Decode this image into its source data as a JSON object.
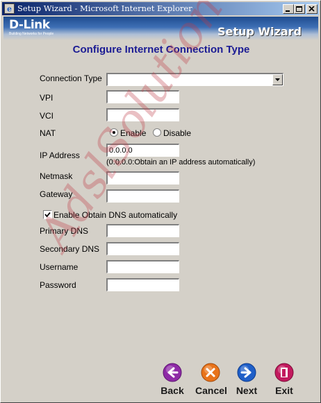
{
  "window": {
    "title": "Setup Wizard - Microsoft Internet Explorer"
  },
  "banner": {
    "logo": "D-Link",
    "tagline": "Building Networks for People",
    "wizard_title": "Setup Wizard"
  },
  "page_title": "Configure Internet Connection Type",
  "form": {
    "connection_type_label": "Connection Type",
    "connection_type_value": "",
    "vpi_label": "VPI",
    "vpi_value": "",
    "vci_label": "VCI",
    "vci_value": "",
    "nat_label": "NAT",
    "nat_enable": "Enable",
    "nat_disable": "Disable",
    "nat_selected": "Enable",
    "ip_label": "IP Address",
    "ip_value": "0.0.0.0",
    "ip_hint": "(0.0.0.0:Obtain an IP address automatically)",
    "netmask_label": "Netmask",
    "netmask_value": "",
    "gateway_label": "Gateway",
    "gateway_value": "",
    "dns_auto_label": "Enable Obtain DNS automatically",
    "dns_auto_checked": true,
    "primary_dns_label": "Primary DNS",
    "primary_dns_value": "",
    "secondary_dns_label": "Secondary DNS",
    "secondary_dns_value": "",
    "username_label": "Username",
    "username_value": "",
    "password_label": "Password",
    "password_value": ""
  },
  "nav": {
    "back": "Back",
    "cancel": "Cancel",
    "next": "Next",
    "exit": "Exit"
  },
  "watermark": "AdslSolution",
  "colors": {
    "title_blue": "#1c1c94",
    "back_purple": "#8e2aa6",
    "cancel_orange": "#e8731a",
    "next_blue": "#1f5fc8",
    "exit_magenta": "#c21a5e"
  }
}
